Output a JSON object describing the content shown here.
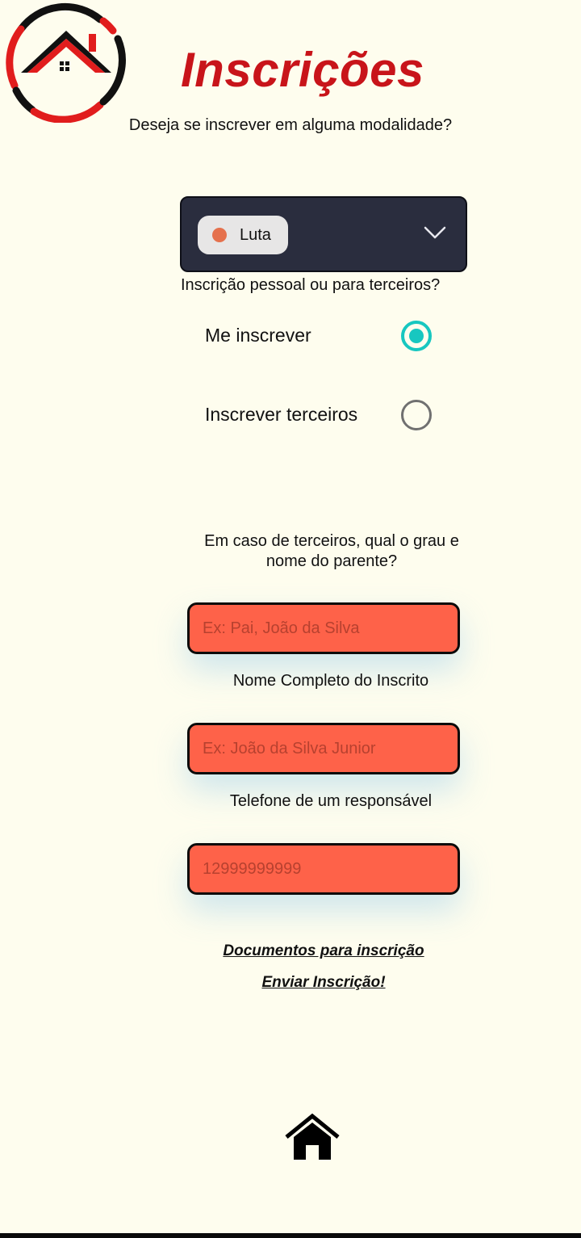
{
  "header": {
    "title": "Inscrições",
    "subtitle": "Deseja se inscrever em alguma modalidade?",
    "logo_icon": "house-logo-icon"
  },
  "modality_select": {
    "selected_value": "Luta",
    "dot_color": "#e5714d",
    "icon": "chevron-down-icon"
  },
  "registration_type": {
    "question": "Inscrição pessoal ou para terceiros?",
    "options": [
      {
        "label": "Me inscrever",
        "checked": true
      },
      {
        "label": "Inscrever terceiros",
        "checked": false
      }
    ]
  },
  "third_party": {
    "question": "Em caso de terceiros, qual o grau e nome do parente?",
    "relative_placeholder": "Ex: Pai, João da Silva",
    "full_name_caption": "Nome Completo do Inscrito",
    "full_name_placeholder": "Ex: João da Silva Junior",
    "phone_caption": "Telefone de um responsável",
    "phone_placeholder": "12999999999"
  },
  "links": {
    "documents": "Documentos para inscrição",
    "submit": "Enviar Inscrição!"
  },
  "nav": {
    "home_icon": "home-icon"
  },
  "colors": {
    "background": "#fefdee",
    "title": "#c8141a",
    "dropdown_bg": "#2a2d3e",
    "input_bg": "#fe6249",
    "radio_accent": "#17c7c0"
  }
}
